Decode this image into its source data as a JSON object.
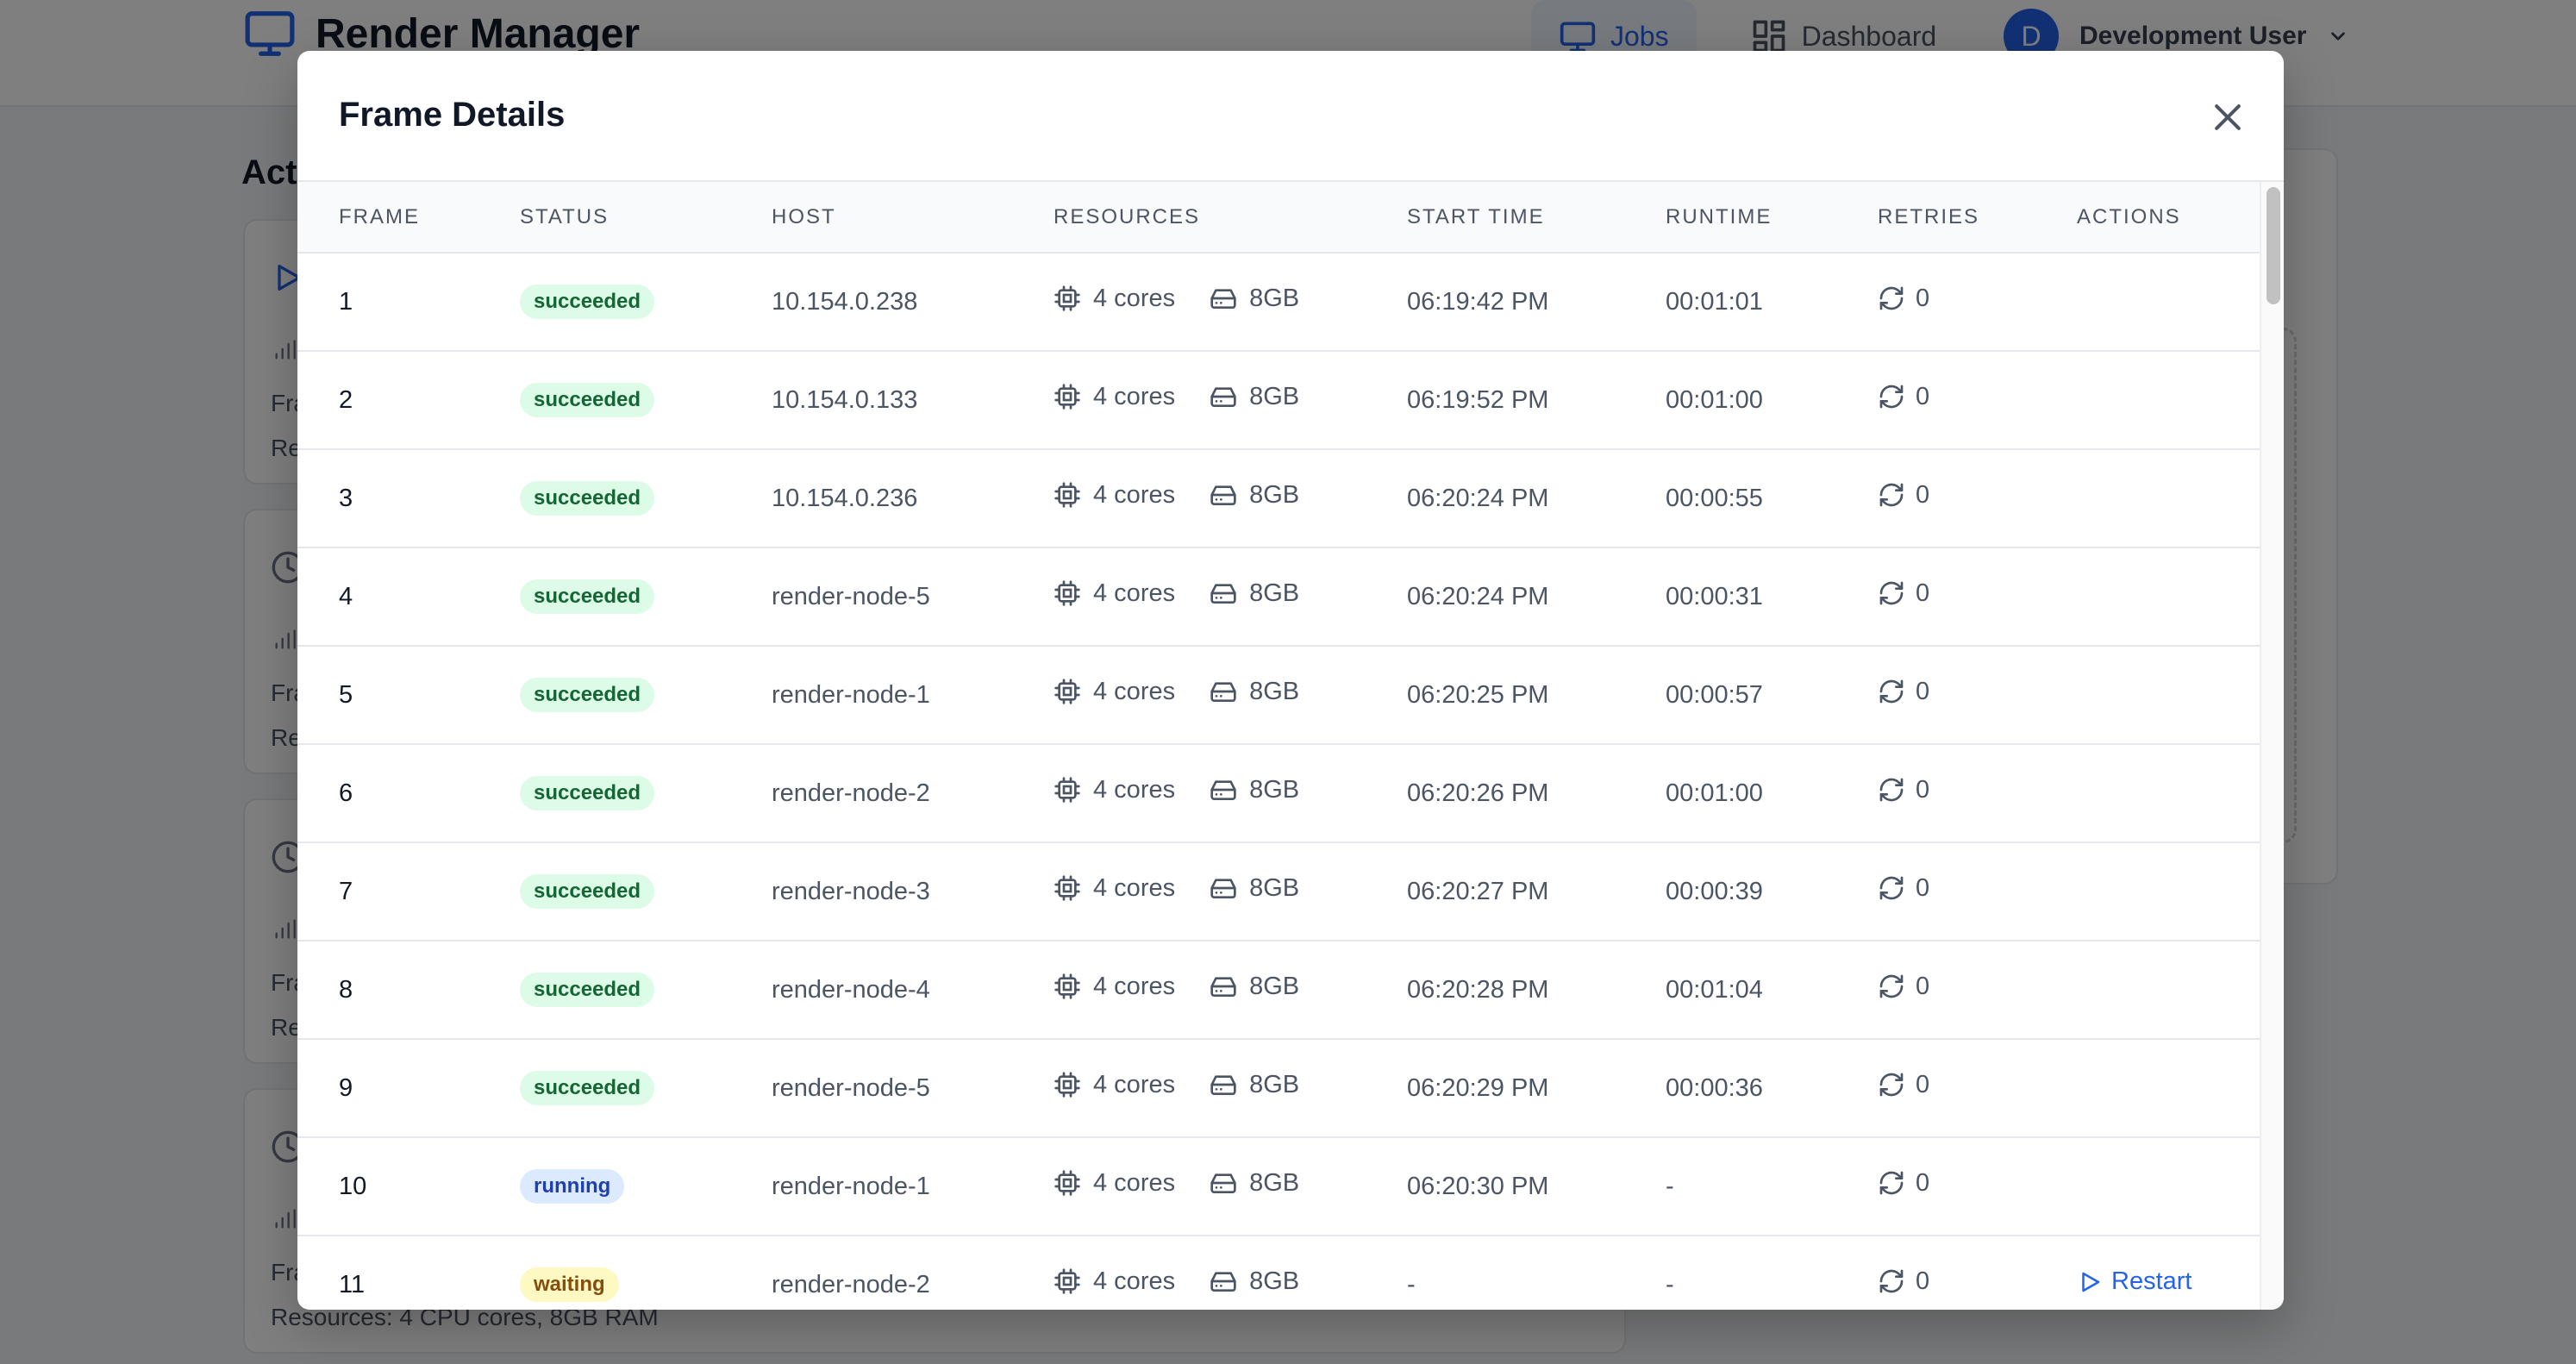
{
  "app": {
    "title": "Render Manager",
    "nav": [
      {
        "label": "Jobs",
        "icon": "monitor-icon",
        "active": true
      },
      {
        "label": "Dashboard",
        "icon": "dashboard-icon",
        "active": false
      }
    ],
    "user": {
      "initial": "D",
      "name": "Development User"
    }
  },
  "background": {
    "heading": "Act",
    "cards": [
      {
        "line1": "Fra",
        "line2": "Re"
      },
      {
        "line1": "Fra",
        "line2": "Re"
      },
      {
        "line1": "Fra",
        "line2": "Re"
      },
      {
        "line1": "Fra",
        "line2": "Resources: 4 CPU cores, 8GB RAM"
      }
    ]
  },
  "modal": {
    "title": "Frame Details",
    "columns": [
      "FRAME",
      "STATUS",
      "HOST",
      "RESOURCES",
      "START TIME",
      "RUNTIME",
      "RETRIES",
      "ACTIONS"
    ],
    "rows": [
      {
        "frame": "1",
        "status": "succeeded",
        "host": "10.154.0.238",
        "cores": "4 cores",
        "mem": "8GB",
        "start": "06:19:42 PM",
        "runtime": "00:01:01",
        "retries": "0",
        "action": ""
      },
      {
        "frame": "2",
        "status": "succeeded",
        "host": "10.154.0.133",
        "cores": "4 cores",
        "mem": "8GB",
        "start": "06:19:52 PM",
        "runtime": "00:01:00",
        "retries": "0",
        "action": ""
      },
      {
        "frame": "3",
        "status": "succeeded",
        "host": "10.154.0.236",
        "cores": "4 cores",
        "mem": "8GB",
        "start": "06:20:24 PM",
        "runtime": "00:00:55",
        "retries": "0",
        "action": ""
      },
      {
        "frame": "4",
        "status": "succeeded",
        "host": "render-node-5",
        "cores": "4 cores",
        "mem": "8GB",
        "start": "06:20:24 PM",
        "runtime": "00:00:31",
        "retries": "0",
        "action": ""
      },
      {
        "frame": "5",
        "status": "succeeded",
        "host": "render-node-1",
        "cores": "4 cores",
        "mem": "8GB",
        "start": "06:20:25 PM",
        "runtime": "00:00:57",
        "retries": "0",
        "action": ""
      },
      {
        "frame": "6",
        "status": "succeeded",
        "host": "render-node-2",
        "cores": "4 cores",
        "mem": "8GB",
        "start": "06:20:26 PM",
        "runtime": "00:01:00",
        "retries": "0",
        "action": ""
      },
      {
        "frame": "7",
        "status": "succeeded",
        "host": "render-node-3",
        "cores": "4 cores",
        "mem": "8GB",
        "start": "06:20:27 PM",
        "runtime": "00:00:39",
        "retries": "0",
        "action": ""
      },
      {
        "frame": "8",
        "status": "succeeded",
        "host": "render-node-4",
        "cores": "4 cores",
        "mem": "8GB",
        "start": "06:20:28 PM",
        "runtime": "00:01:04",
        "retries": "0",
        "action": ""
      },
      {
        "frame": "9",
        "status": "succeeded",
        "host": "render-node-5",
        "cores": "4 cores",
        "mem": "8GB",
        "start": "06:20:29 PM",
        "runtime": "00:00:36",
        "retries": "0",
        "action": ""
      },
      {
        "frame": "10",
        "status": "running",
        "host": "render-node-1",
        "cores": "4 cores",
        "mem": "8GB",
        "start": "06:20:30 PM",
        "runtime": "-",
        "retries": "0",
        "action": ""
      },
      {
        "frame": "11",
        "status": "waiting",
        "host": "render-node-2",
        "cores": "4 cores",
        "mem": "8GB",
        "start": "-",
        "runtime": "-",
        "retries": "0",
        "action": "Restart"
      }
    ]
  },
  "colors": {
    "accent": "#2563eb",
    "succeeded_bg": "#dcfce7",
    "succeeded_fg": "#166534",
    "running_bg": "#dbeafe",
    "running_fg": "#1e40af",
    "waiting_bg": "#fef9c3",
    "waiting_fg": "#854d0e"
  }
}
